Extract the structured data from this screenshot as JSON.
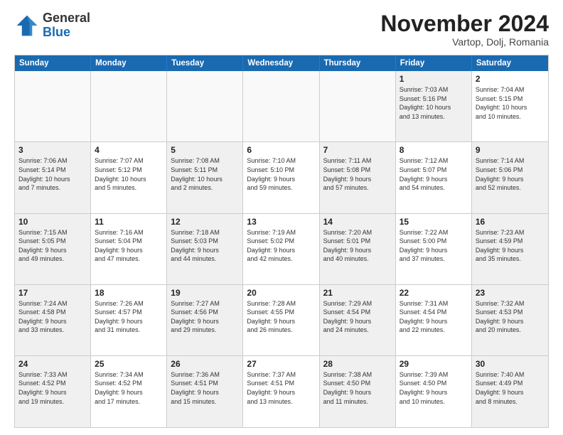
{
  "logo": {
    "general": "General",
    "blue": "Blue"
  },
  "title": "November 2024",
  "location": "Vartop, Dolj, Romania",
  "days_of_week": [
    "Sunday",
    "Monday",
    "Tuesday",
    "Wednesday",
    "Thursday",
    "Friday",
    "Saturday"
  ],
  "weeks": [
    [
      {
        "day": "",
        "info": "",
        "empty": true
      },
      {
        "day": "",
        "info": "",
        "empty": true
      },
      {
        "day": "",
        "info": "",
        "empty": true
      },
      {
        "day": "",
        "info": "",
        "empty": true
      },
      {
        "day": "",
        "info": "",
        "empty": true
      },
      {
        "day": "1",
        "info": "Sunrise: 7:03 AM\nSunset: 5:16 PM\nDaylight: 10 hours\nand 13 minutes.",
        "empty": false,
        "shaded": true
      },
      {
        "day": "2",
        "info": "Sunrise: 7:04 AM\nSunset: 5:15 PM\nDaylight: 10 hours\nand 10 minutes.",
        "empty": false
      }
    ],
    [
      {
        "day": "3",
        "info": "Sunrise: 7:06 AM\nSunset: 5:14 PM\nDaylight: 10 hours\nand 7 minutes.",
        "empty": false,
        "shaded": true
      },
      {
        "day": "4",
        "info": "Sunrise: 7:07 AM\nSunset: 5:12 PM\nDaylight: 10 hours\nand 5 minutes.",
        "empty": false
      },
      {
        "day": "5",
        "info": "Sunrise: 7:08 AM\nSunset: 5:11 PM\nDaylight: 10 hours\nand 2 minutes.",
        "empty": false,
        "shaded": true
      },
      {
        "day": "6",
        "info": "Sunrise: 7:10 AM\nSunset: 5:10 PM\nDaylight: 9 hours\nand 59 minutes.",
        "empty": false
      },
      {
        "day": "7",
        "info": "Sunrise: 7:11 AM\nSunset: 5:08 PM\nDaylight: 9 hours\nand 57 minutes.",
        "empty": false,
        "shaded": true
      },
      {
        "day": "8",
        "info": "Sunrise: 7:12 AM\nSunset: 5:07 PM\nDaylight: 9 hours\nand 54 minutes.",
        "empty": false
      },
      {
        "day": "9",
        "info": "Sunrise: 7:14 AM\nSunset: 5:06 PM\nDaylight: 9 hours\nand 52 minutes.",
        "empty": false,
        "shaded": true
      }
    ],
    [
      {
        "day": "10",
        "info": "Sunrise: 7:15 AM\nSunset: 5:05 PM\nDaylight: 9 hours\nand 49 minutes.",
        "empty": false,
        "shaded": true
      },
      {
        "day": "11",
        "info": "Sunrise: 7:16 AM\nSunset: 5:04 PM\nDaylight: 9 hours\nand 47 minutes.",
        "empty": false
      },
      {
        "day": "12",
        "info": "Sunrise: 7:18 AM\nSunset: 5:03 PM\nDaylight: 9 hours\nand 44 minutes.",
        "empty": false,
        "shaded": true
      },
      {
        "day": "13",
        "info": "Sunrise: 7:19 AM\nSunset: 5:02 PM\nDaylight: 9 hours\nand 42 minutes.",
        "empty": false
      },
      {
        "day": "14",
        "info": "Sunrise: 7:20 AM\nSunset: 5:01 PM\nDaylight: 9 hours\nand 40 minutes.",
        "empty": false,
        "shaded": true
      },
      {
        "day": "15",
        "info": "Sunrise: 7:22 AM\nSunset: 5:00 PM\nDaylight: 9 hours\nand 37 minutes.",
        "empty": false
      },
      {
        "day": "16",
        "info": "Sunrise: 7:23 AM\nSunset: 4:59 PM\nDaylight: 9 hours\nand 35 minutes.",
        "empty": false,
        "shaded": true
      }
    ],
    [
      {
        "day": "17",
        "info": "Sunrise: 7:24 AM\nSunset: 4:58 PM\nDaylight: 9 hours\nand 33 minutes.",
        "empty": false,
        "shaded": true
      },
      {
        "day": "18",
        "info": "Sunrise: 7:26 AM\nSunset: 4:57 PM\nDaylight: 9 hours\nand 31 minutes.",
        "empty": false
      },
      {
        "day": "19",
        "info": "Sunrise: 7:27 AM\nSunset: 4:56 PM\nDaylight: 9 hours\nand 29 minutes.",
        "empty": false,
        "shaded": true
      },
      {
        "day": "20",
        "info": "Sunrise: 7:28 AM\nSunset: 4:55 PM\nDaylight: 9 hours\nand 26 minutes.",
        "empty": false
      },
      {
        "day": "21",
        "info": "Sunrise: 7:29 AM\nSunset: 4:54 PM\nDaylight: 9 hours\nand 24 minutes.",
        "empty": false,
        "shaded": true
      },
      {
        "day": "22",
        "info": "Sunrise: 7:31 AM\nSunset: 4:54 PM\nDaylight: 9 hours\nand 22 minutes.",
        "empty": false
      },
      {
        "day": "23",
        "info": "Sunrise: 7:32 AM\nSunset: 4:53 PM\nDaylight: 9 hours\nand 20 minutes.",
        "empty": false,
        "shaded": true
      }
    ],
    [
      {
        "day": "24",
        "info": "Sunrise: 7:33 AM\nSunset: 4:52 PM\nDaylight: 9 hours\nand 19 minutes.",
        "empty": false,
        "shaded": true
      },
      {
        "day": "25",
        "info": "Sunrise: 7:34 AM\nSunset: 4:52 PM\nDaylight: 9 hours\nand 17 minutes.",
        "empty": false
      },
      {
        "day": "26",
        "info": "Sunrise: 7:36 AM\nSunset: 4:51 PM\nDaylight: 9 hours\nand 15 minutes.",
        "empty": false,
        "shaded": true
      },
      {
        "day": "27",
        "info": "Sunrise: 7:37 AM\nSunset: 4:51 PM\nDaylight: 9 hours\nand 13 minutes.",
        "empty": false
      },
      {
        "day": "28",
        "info": "Sunrise: 7:38 AM\nSunset: 4:50 PM\nDaylight: 9 hours\nand 11 minutes.",
        "empty": false,
        "shaded": true
      },
      {
        "day": "29",
        "info": "Sunrise: 7:39 AM\nSunset: 4:50 PM\nDaylight: 9 hours\nand 10 minutes.",
        "empty": false
      },
      {
        "day": "30",
        "info": "Sunrise: 7:40 AM\nSunset: 4:49 PM\nDaylight: 9 hours\nand 8 minutes.",
        "empty": false,
        "shaded": true
      }
    ]
  ]
}
